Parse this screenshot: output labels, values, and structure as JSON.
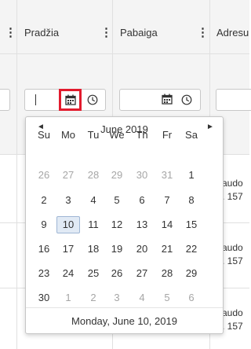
{
  "columns": [
    {
      "label": "",
      "menu": "⋮"
    },
    {
      "label": "Pradžia",
      "menu": "⋮"
    },
    {
      "label": "Pabaiga",
      "menu": "⋮"
    },
    {
      "label": "Adresu",
      "menu": ""
    }
  ],
  "filters": {
    "start_value": "",
    "end_value": ""
  },
  "rows": [
    {
      "line1": "audo",
      "line2": ". 157"
    },
    {
      "line1": "audo",
      "line2": ". 157"
    },
    {
      "line1": "audo",
      "line2": ". 157"
    }
  ],
  "calendar": {
    "prev": "◄",
    "next": "►",
    "title": "June 2019",
    "weekdays": [
      "Su",
      "Mo",
      "Tu",
      "We",
      "Th",
      "Fr",
      "Sa"
    ],
    "weeks": [
      [
        "26",
        "27",
        "28",
        "29",
        "30",
        "31",
        "1"
      ],
      [
        "2",
        "3",
        "4",
        "5",
        "6",
        "7",
        "8"
      ],
      [
        "9",
        "10",
        "11",
        "12",
        "13",
        "14",
        "15"
      ],
      [
        "16",
        "17",
        "18",
        "19",
        "20",
        "21",
        "22"
      ],
      [
        "23",
        "24",
        "25",
        "26",
        "27",
        "28",
        "29"
      ],
      [
        "30",
        "1",
        "2",
        "3",
        "4",
        "5",
        "6"
      ]
    ],
    "other_month": [
      [
        true,
        true,
        true,
        true,
        true,
        true,
        false
      ],
      [
        false,
        false,
        false,
        false,
        false,
        false,
        false
      ],
      [
        false,
        false,
        false,
        false,
        false,
        false,
        false
      ],
      [
        false,
        false,
        false,
        false,
        false,
        false,
        false
      ],
      [
        false,
        false,
        false,
        false,
        false,
        false,
        false
      ],
      [
        false,
        true,
        true,
        true,
        true,
        true,
        true
      ]
    ],
    "selected": "10",
    "footer": "Monday, June 10, 2019"
  },
  "colors": {
    "highlight_border": "#e21b2d",
    "selected_bg": "#e1eaf5"
  },
  "icons": {
    "calendar": "calendar-icon",
    "clock": "clock-icon",
    "menu": "kebab-menu-icon"
  }
}
